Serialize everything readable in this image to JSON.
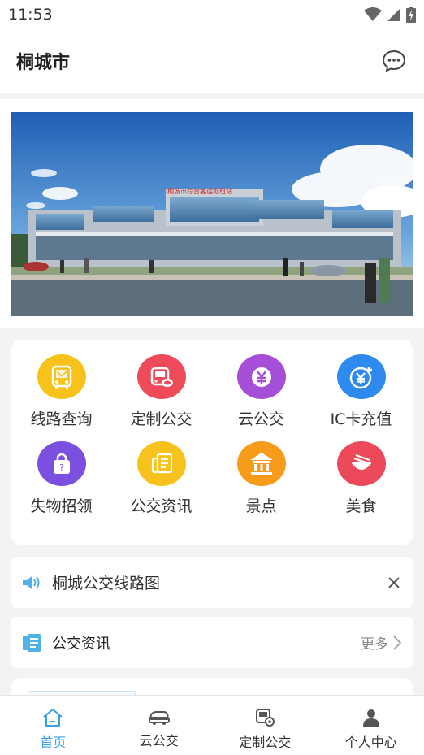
{
  "status_bar": {
    "time": "11:53"
  },
  "header": {
    "title": "桐城市"
  },
  "banner": {
    "sign_text": "桐城市综合客运枢纽站"
  },
  "grid": {
    "items": [
      {
        "label": "线路查询",
        "icon": "bus-route-icon",
        "color": "#f8c21a"
      },
      {
        "label": "定制公交",
        "icon": "custom-bus-icon",
        "color": "#ef4a5a"
      },
      {
        "label": "云公交",
        "icon": "yen-coin-icon",
        "color": "#a54fd9"
      },
      {
        "label": "IC卡充值",
        "icon": "card-recharge-icon",
        "color": "#2f8af0"
      },
      {
        "label": "失物招领",
        "icon": "lost-bag-icon",
        "color": "#7b4fe0"
      },
      {
        "label": "公交资讯",
        "icon": "news-doc-icon",
        "color": "#f7c21b"
      },
      {
        "label": "景点",
        "icon": "pavilion-icon",
        "color": "#f79c1a"
      },
      {
        "label": "美食",
        "icon": "food-bowl-icon",
        "color": "#ec4a5b"
      }
    ]
  },
  "notice": {
    "text": "桐城公交线路图"
  },
  "news": {
    "title": "公交资讯",
    "more": "更多"
  },
  "nav": {
    "items": [
      {
        "label": "首页",
        "icon": "home-icon",
        "active": true
      },
      {
        "label": "云公交",
        "icon": "bus-icon",
        "active": false
      },
      {
        "label": "定制公交",
        "icon": "custom-bus-icon",
        "active": false
      },
      {
        "label": "个人中心",
        "icon": "user-icon",
        "active": false
      }
    ]
  },
  "colors": {
    "accent": "#3aa0e6",
    "background": "#f3f3f3"
  }
}
